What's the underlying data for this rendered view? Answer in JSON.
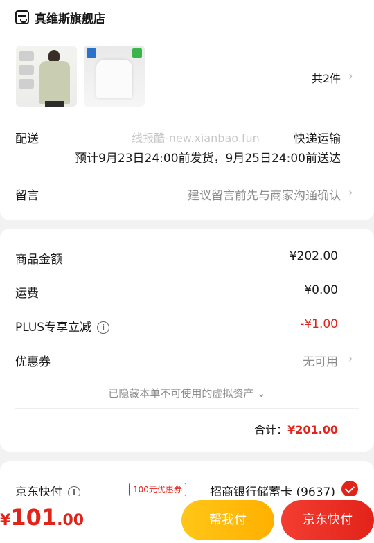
{
  "store": {
    "name": "真维斯旗舰店",
    "icon": "store-icon"
  },
  "products": {
    "count_text": "共2件"
  },
  "delivery": {
    "label": "配送",
    "method": "快递运输",
    "estimate": "预计9月23日24:00前发货，9月25日24:00前送达",
    "watermark": "线报酷-new.xianbao.fun"
  },
  "message": {
    "label": "留言",
    "placeholder": "建议留言前先与商家沟通确认"
  },
  "amounts": {
    "goods_label": "商品金额",
    "goods_value": "¥202.00",
    "shipping_label": "运费",
    "shipping_value": "¥0.00",
    "plus_label": "PLUS专享立减",
    "plus_value": "-¥1.00",
    "coupon_label": "优惠券",
    "coupon_value": "无可用",
    "hidden_assets": "已隐藏本单不可使用的虚拟资产",
    "total_label": "合计：",
    "total_value": "¥201.00"
  },
  "payment": {
    "label": "京东快付",
    "coupon_tag": "100元优惠券",
    "card": "招商银行储蓄卡 (9637)"
  },
  "bottom": {
    "price_symbol": "¥",
    "price_int": "101",
    "price_dec": ".00",
    "help_pay": "帮我付",
    "jd_pay": "京东快付"
  },
  "colors": {
    "accent_red": "#e2231a",
    "yellow_button": "#ffc617"
  }
}
